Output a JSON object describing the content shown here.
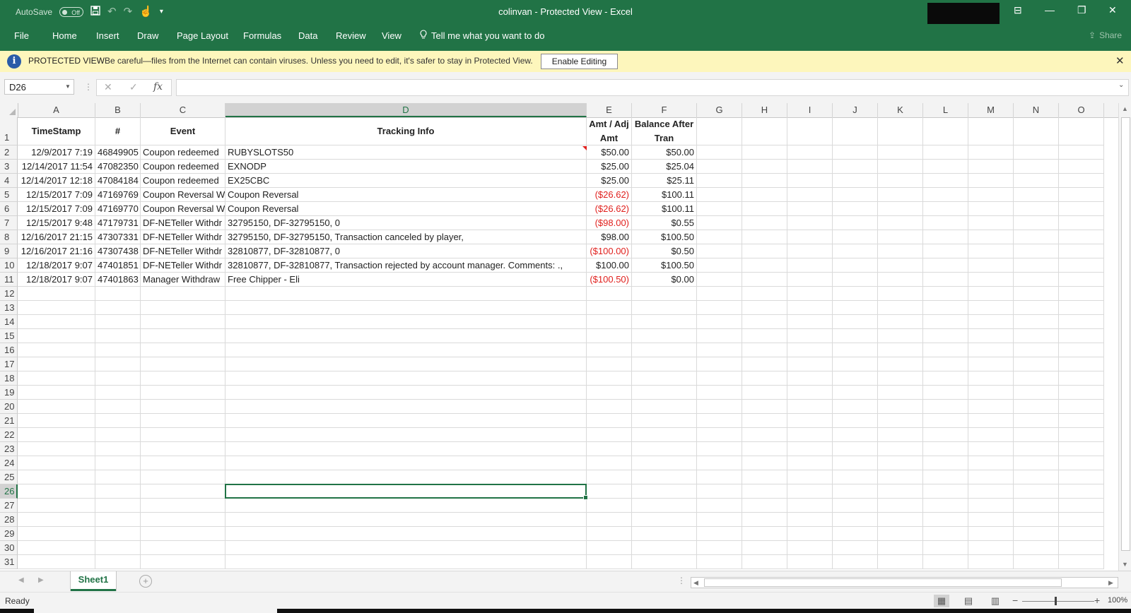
{
  "window": {
    "title": "colinvan  -  Protected View  -  Excel",
    "autosave_label": "AutoSave",
    "autosave_state": "Off",
    "controls": {
      "restore_ribbon": "⊟",
      "minimize": "—",
      "maximize": "❐",
      "close": "✕"
    }
  },
  "ribbon": {
    "tabs": [
      "File",
      "Home",
      "Insert",
      "Draw",
      "Page Layout",
      "Formulas",
      "Data",
      "Review",
      "View"
    ],
    "tell_me": "Tell me what you want to do",
    "share": "Share"
  },
  "protected_view": {
    "title": "PROTECTED VIEW",
    "message": "Be careful—files from the Internet can contain viruses. Unless you need to edit, it's safer to stay in Protected View.",
    "button": "Enable Editing"
  },
  "formula_bar": {
    "name_box": "D26",
    "formula": "",
    "cancel_glyph": "✕",
    "enter_glyph": "✓",
    "fx_glyph": "fx"
  },
  "grid": {
    "columns": [
      "A",
      "B",
      "C",
      "D",
      "E",
      "F",
      "G",
      "H",
      "I",
      "J",
      "K",
      "L",
      "M",
      "N",
      "O"
    ],
    "row_numbers": [
      "1",
      "2",
      "3",
      "4",
      "5",
      "6",
      "7",
      "8",
      "9",
      "10",
      "11",
      "12",
      "13",
      "14",
      "15",
      "16",
      "17",
      "18",
      "19",
      "20",
      "21",
      "22",
      "23",
      "24",
      "25",
      "26",
      "27",
      "28",
      "29",
      "30",
      "31"
    ],
    "header": {
      "timestamp": "TimeStamp",
      "number": "#",
      "event": "Event",
      "tracking": "Tracking Info",
      "amt_line1": "Amt / Adj",
      "amt_line2": "Amt",
      "bal_line1": "Balance After",
      "bal_line2": "Tran"
    },
    "rows": [
      {
        "timestamp": "12/9/2017 7:19",
        "number": "46849905",
        "event": "Coupon redeemed",
        "tracking": "RUBYSLOTS50",
        "amount": "$50.00",
        "negative": false,
        "balance": "$50.00"
      },
      {
        "timestamp": "12/14/2017 11:54",
        "number": "47082350",
        "event": "Coupon redeemed",
        "tracking": "EXNODP",
        "amount": "$25.00",
        "negative": false,
        "balance": "$25.04"
      },
      {
        "timestamp": "12/14/2017 12:18",
        "number": "47084184",
        "event": "Coupon redeemed",
        "tracking": "EX25CBC",
        "amount": "$25.00",
        "negative": false,
        "balance": "$25.11"
      },
      {
        "timestamp": "12/15/2017 7:09",
        "number": "47169769",
        "event": "Coupon Reversal W",
        "tracking": "Coupon Reversal",
        "amount": "($26.62)",
        "negative": true,
        "balance": "$100.11"
      },
      {
        "timestamp": "12/15/2017 7:09",
        "number": "47169770",
        "event": "Coupon Reversal W",
        "tracking": "Coupon Reversal",
        "amount": "($26.62)",
        "negative": true,
        "balance": "$100.11"
      },
      {
        "timestamp": "12/15/2017 9:48",
        "number": "47179731",
        "event": "DF-NETeller Withdr",
        "tracking": "32795150, DF-32795150, 0",
        "amount": "($98.00)",
        "negative": true,
        "balance": "$0.55"
      },
      {
        "timestamp": "12/16/2017 21:15",
        "number": "47307331",
        "event": "DF-NETeller Withdr",
        "tracking": "32795150, DF-32795150, Transaction canceled by player,",
        "amount": "$98.00",
        "negative": false,
        "balance": "$100.50"
      },
      {
        "timestamp": "12/16/2017 21:16",
        "number": "47307438",
        "event": "DF-NETeller Withdr",
        "tracking": "32810877, DF-32810877, 0",
        "amount": "($100.00)",
        "negative": true,
        "balance": "$0.50"
      },
      {
        "timestamp": "12/18/2017 9:07",
        "number": "47401851",
        "event": "DF-NETeller Withdr",
        "tracking": "32810877, DF-32810877, Transaction rejected by account manager. Comments: .,",
        "amount": "$100.00",
        "negative": false,
        "balance": "$100.50"
      },
      {
        "timestamp": "12/18/2017 9:07",
        "number": "47401863",
        "event": "Manager Withdraw",
        "tracking": "Free Chipper - Eli",
        "amount": "($100.50)",
        "negative": true,
        "balance": "$0.00"
      }
    ],
    "active_cell": "D26",
    "negative_color": "#e0201d",
    "accent_color": "#217346"
  },
  "sheets": {
    "tabs": [
      "Sheet1"
    ],
    "active": "Sheet1",
    "add_glyph": "+"
  },
  "status": {
    "text": "Ready",
    "zoom": "100%"
  }
}
